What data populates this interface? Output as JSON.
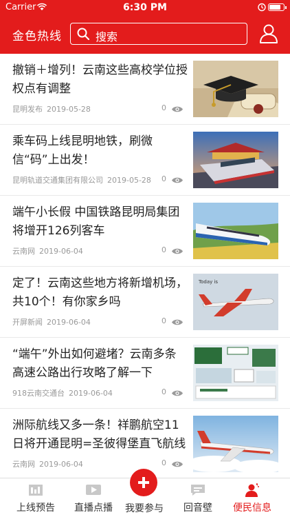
{
  "status_bar": {
    "carrier": "Carrier",
    "time": "6:30 PM"
  },
  "header": {
    "title": "金色热线",
    "search_placeholder": "搜索"
  },
  "colors": {
    "brand_red": "#e31c1c"
  },
  "articles": [
    {
      "title": "撤销＋增列！云南这些高校学位授权点有调整",
      "source": "昆明发布",
      "date": "2019-05-28",
      "views": "0",
      "image": "graduation-cap-diploma"
    },
    {
      "title": "乘车码上线昆明地铁，刷微信“码”上出发！",
      "source": "昆明轨道交通集团有限公司",
      "date": "2019-05-28",
      "views": "0",
      "image": "metro-train"
    },
    {
      "title": "端午小长假 中国铁路昆明局集团将增开126列客车",
      "source": "云南网",
      "date": "2019-06-04",
      "views": "0",
      "image": "high-speed-train"
    },
    {
      "title": "定了！云南这些地方将新增机场，共10个！有你家乡吗",
      "source": "开屏新闻",
      "date": "2019-06-04",
      "views": "0",
      "image": "airplane"
    },
    {
      "title": "“端午”外出如何避堵？云南多条高速公路出行攻略了解一下",
      "source": "918云南交通台",
      "date": "2019-06-04",
      "views": "0",
      "image": "highway-infographic"
    },
    {
      "title": "洲际航线又多一条！祥鹏航空11日将开通昆明=圣彼得堡直飞航线",
      "source": "云南网",
      "date": "2019-06-04",
      "views": "0",
      "image": "airplane-sky"
    }
  ],
  "tabs": [
    {
      "label": "上线预告",
      "icon": "schedule-icon"
    },
    {
      "label": "直播点播",
      "icon": "video-play-icon"
    },
    {
      "label": "我要参与",
      "icon": "plus-icon"
    },
    {
      "label": "回音壁",
      "icon": "chat-bubble-icon"
    },
    {
      "label": "便民信息",
      "icon": "person-service-icon",
      "active": true
    }
  ]
}
